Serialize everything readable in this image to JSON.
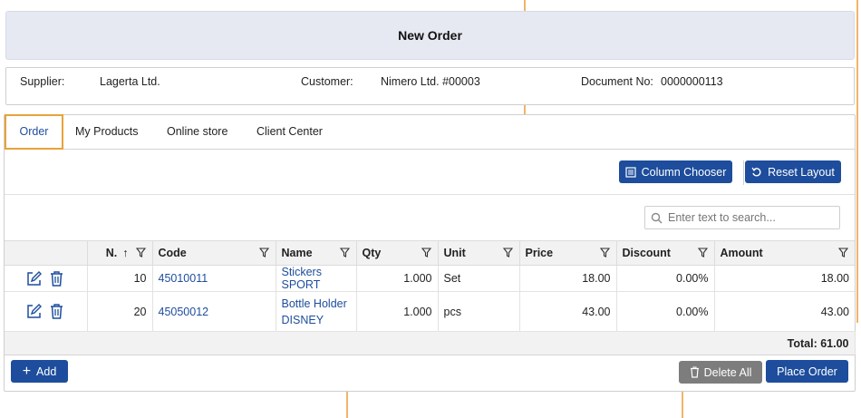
{
  "window": {
    "title": "New Order"
  },
  "info": {
    "supplier_label": "Supplier:",
    "supplier_value": "Lagerta Ltd.",
    "customer_label": "Customer:",
    "customer_value": "Nimero Ltd. #00003",
    "docno_label": "Document No:",
    "docno_value": "0000000113"
  },
  "tabs": [
    {
      "label": "Order",
      "active": true
    },
    {
      "label": "My Products"
    },
    {
      "label": "Online store"
    },
    {
      "label": "Client Center"
    }
  ],
  "toolbar": {
    "column_chooser": "Column Chooser",
    "reset_layout": "Reset Layout"
  },
  "search": {
    "placeholder": "Enter text to search..."
  },
  "grid": {
    "columns": [
      "N.",
      "Code",
      "Name",
      "Qty",
      "Unit",
      "Price",
      "Discount",
      "Amount"
    ],
    "rows": [
      {
        "n": "10",
        "code": "45010011",
        "name": "Stickers SPORT",
        "qty": "1.000",
        "unit": "Set",
        "price": "18.00",
        "discount": "0.00%",
        "amount": "18.00"
      },
      {
        "n": "20",
        "code": "45050012",
        "name_line1": "Bottle Holder",
        "name_line2": "DISNEY",
        "qty": "1.000",
        "unit": "pcs",
        "price": "43.00",
        "discount": "0.00%",
        "amount": "43.00"
      }
    ],
    "total": "Total: 61.00"
  },
  "footer": {
    "add": "Add",
    "delete_all": "Delete All",
    "place_order": "Place Order"
  },
  "colors": {
    "accent": "#1d4d9c",
    "tab_highlight": "#e8a23b",
    "grey_button": "#7d7d7d"
  }
}
